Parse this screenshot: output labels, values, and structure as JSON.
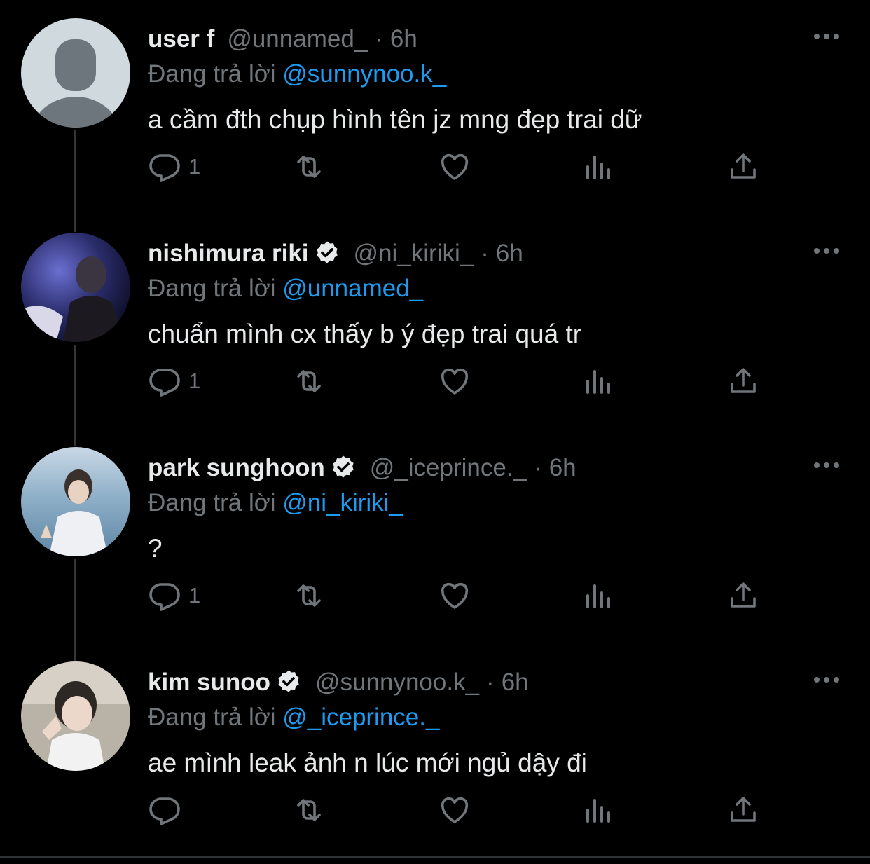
{
  "tweets": [
    {
      "name": "user f",
      "verified": false,
      "handle": "@unnamed_",
      "dot": "·",
      "time": "6h",
      "reply_prefix": "Đang trả lời",
      "reply_to": "@sunnynoo.k_",
      "text": "a cầm đth chụp hình tên jz mng đẹp trai dữ",
      "reply_count": "1",
      "avatar": "default-avatar"
    },
    {
      "name": "nishimura riki",
      "verified": true,
      "handle": "@ni_kiriki_",
      "dot": "·",
      "time": "6h",
      "reply_prefix": "Đang trả lời",
      "reply_to": "@unnamed_",
      "text": "chuẩn mình cx thấy b ý đẹp trai quá tr",
      "reply_count": "1",
      "avatar": "photo-avatar"
    },
    {
      "name": "park sunghoon",
      "verified": true,
      "handle": "@_iceprince._",
      "dot": "·",
      "time": "6h",
      "reply_prefix": "Đang trả lời",
      "reply_to": "@ni_kiriki_",
      "text": "?",
      "reply_count": "1",
      "avatar": "photo-avatar"
    },
    {
      "name": "kim sunoo",
      "verified": true,
      "handle": "@sunnynoo.k_",
      "dot": "·",
      "time": "6h",
      "reply_prefix": "Đang trả lời",
      "reply_to": "@_iceprince._",
      "text": "ae mình leak ảnh n lúc mới ngủ dậy đi",
      "reply_count": "",
      "avatar": "photo-avatar"
    }
  ],
  "colors": {
    "background": "#000000",
    "text": "#e7e9ea",
    "secondary": "#71767b",
    "mention": "#1d9bf0",
    "thread_line": "#333639"
  },
  "icons": [
    "reply-icon",
    "retweet-icon",
    "like-icon",
    "views-icon",
    "share-icon",
    "more-icon",
    "verified-icon"
  ]
}
